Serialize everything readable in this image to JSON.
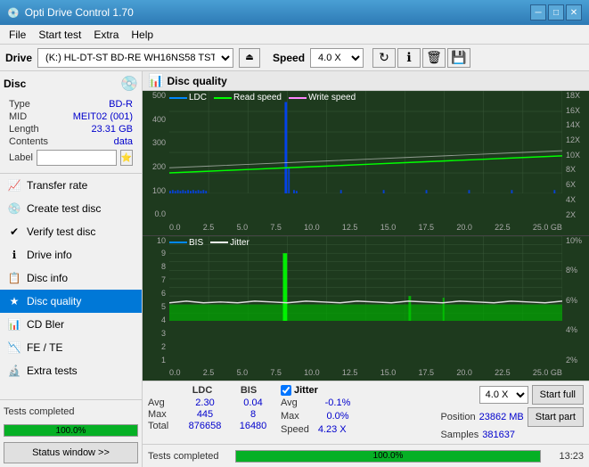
{
  "titleBar": {
    "title": "Opti Drive Control 1.70",
    "minBtn": "─",
    "maxBtn": "□",
    "closeBtn": "✕"
  },
  "menuBar": {
    "items": [
      "File",
      "Start test",
      "Extra",
      "Help"
    ]
  },
  "driveBar": {
    "label": "Drive",
    "driveValue": "(K:)  HL-DT-ST BD-RE  WH16NS58 TST4",
    "ejectIcon": "⏏",
    "speedLabel": "Speed",
    "speedValue": "4.0 X"
  },
  "disc": {
    "title": "Disc",
    "type": {
      "label": "Type",
      "value": "BD-R"
    },
    "mid": {
      "label": "MID",
      "value": "MEIT02 (001)"
    },
    "length": {
      "label": "Length",
      "value": "23.31 GB"
    },
    "contents": {
      "label": "Contents",
      "value": "data"
    },
    "labelText": {
      "label": "Label",
      "value": ""
    }
  },
  "navItems": [
    {
      "id": "transfer-rate",
      "label": "Transfer rate",
      "icon": "📈"
    },
    {
      "id": "create-test-disc",
      "label": "Create test disc",
      "icon": "💿"
    },
    {
      "id": "verify-test-disc",
      "label": "Verify test disc",
      "icon": "✔"
    },
    {
      "id": "drive-info",
      "label": "Drive info",
      "icon": "ℹ"
    },
    {
      "id": "disc-info",
      "label": "Disc info",
      "icon": "📋"
    },
    {
      "id": "disc-quality",
      "label": "Disc quality",
      "icon": "★",
      "active": true
    },
    {
      "id": "cd-bler",
      "label": "CD Bler",
      "icon": "📊"
    },
    {
      "id": "fe-te",
      "label": "FE / TE",
      "icon": "📉"
    },
    {
      "id": "extra-tests",
      "label": "Extra tests",
      "icon": "🔬"
    }
  ],
  "statusWindowBtn": "Status window >>",
  "chartPanel": {
    "title": "Disc quality",
    "topChart": {
      "legend": [
        {
          "label": "LDC",
          "color": "#0088ff"
        },
        {
          "label": "Read speed",
          "color": "#00ff00"
        },
        {
          "label": "Write speed",
          "color": "#ff88ff"
        }
      ],
      "yAxisLeft": [
        "500",
        "400",
        "300",
        "200",
        "100",
        "0.0"
      ],
      "yAxisRight": [
        "18X",
        "16X",
        "14X",
        "12X",
        "10X",
        "8X",
        "6X",
        "4X",
        "2X"
      ],
      "xAxis": [
        "0.0",
        "2.5",
        "5.0",
        "7.5",
        "10.0",
        "12.5",
        "15.0",
        "17.5",
        "20.0",
        "22.5",
        "25.0 GB"
      ]
    },
    "bottomChart": {
      "legend": [
        {
          "label": "BIS",
          "color": "#0088ff"
        },
        {
          "label": "Jitter",
          "color": "#ffffff"
        }
      ],
      "yAxisLeft": [
        "10",
        "9",
        "8",
        "7",
        "6",
        "5",
        "4",
        "3",
        "2",
        "1"
      ],
      "yAxisRight": [
        "10%",
        "8%",
        "6%",
        "4%",
        "2%"
      ],
      "xAxis": [
        "0.0",
        "2.5",
        "5.0",
        "7.5",
        "10.0",
        "12.5",
        "15.0",
        "17.5",
        "20.0",
        "22.5",
        "25.0 GB"
      ]
    }
  },
  "statsPanel": {
    "headers": [
      "LDC",
      "BIS"
    ],
    "jitterLabel": "Jitter",
    "rows": [
      {
        "label": "Avg",
        "ldc": "2.30",
        "bis": "0.04",
        "jitter": "-0.1%"
      },
      {
        "label": "Max",
        "ldc": "445",
        "bis": "8",
        "jitter": "0.0%"
      },
      {
        "label": "Total",
        "ldc": "876658",
        "bis": "16480",
        "jitter": ""
      }
    ],
    "speedLabel": "Speed",
    "speedValue": "4.23 X",
    "speedSelectValue": "4.0 X",
    "positionLabel": "Position",
    "positionValue": "23862 MB",
    "samplesLabel": "Samples",
    "samplesValue": "381637",
    "startFullBtn": "Start full",
    "startPartBtn": "Start part"
  },
  "statusBar": {
    "text": "Tests completed",
    "progress": "100.0%",
    "time": "13:23"
  }
}
